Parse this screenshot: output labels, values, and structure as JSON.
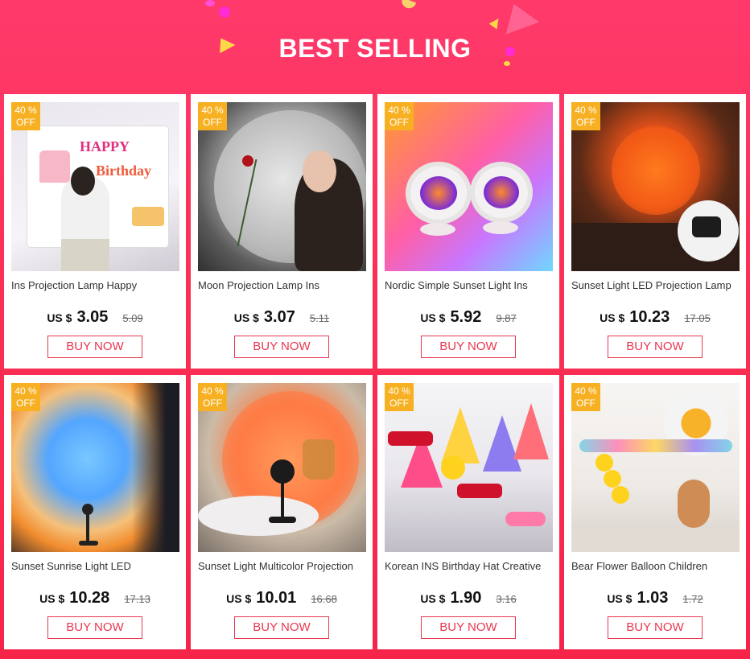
{
  "banner": {
    "title": "BEST SELLING"
  },
  "currency_label": "US $",
  "buy_label": "BUY NOW",
  "products": [
    {
      "badge_pct": "40 %",
      "badge_off": "OFF",
      "name": "Ins Projection Lamp Happy",
      "price": "3.05",
      "old_price": "5.09",
      "image": "happy-birthday-projection-photo"
    },
    {
      "badge_pct": "40 %",
      "badge_off": "OFF",
      "name": "Moon Projection Lamp Ins",
      "price": "3.07",
      "old_price": "5.11",
      "image": "moon-projection-photo"
    },
    {
      "badge_pct": "40 %",
      "badge_off": "OFF",
      "name": "Nordic Simple Sunset Light Ins",
      "price": "5.92",
      "old_price": "9.87",
      "image": "sunset-light-cat-ear-photo"
    },
    {
      "badge_pct": "40 %",
      "badge_off": "OFF",
      "name": "Sunset Light LED Projection Lamp",
      "price": "10.23",
      "old_price": "17.05",
      "image": "sunset-led-projection-photo"
    },
    {
      "badge_pct": "40 %",
      "badge_off": "OFF",
      "name": "Sunset Sunrise Light LED",
      "price": "10.28",
      "old_price": "17.13",
      "image": "sunset-sunrise-light-photo"
    },
    {
      "badge_pct": "40 %",
      "badge_off": "OFF",
      "name": "Sunset Light Multicolor Projection",
      "price": "10.01",
      "old_price": "16.68",
      "image": "multicolor-projection-photo"
    },
    {
      "badge_pct": "40 %",
      "badge_off": "OFF",
      "name": "Korean INS Birthday Hat Creative",
      "price": "1.90",
      "old_price": "3.16",
      "image": "birthday-hats-photo"
    },
    {
      "badge_pct": "40 %",
      "badge_off": "OFF",
      "name": "Bear Flower Balloon Children",
      "price": "1.03",
      "old_price": "1.72",
      "image": "bear-flower-balloon-photo"
    }
  ],
  "colors": {
    "background": "#fb2f55",
    "badge": "#f7b021",
    "buy_border": "#e8374f"
  }
}
